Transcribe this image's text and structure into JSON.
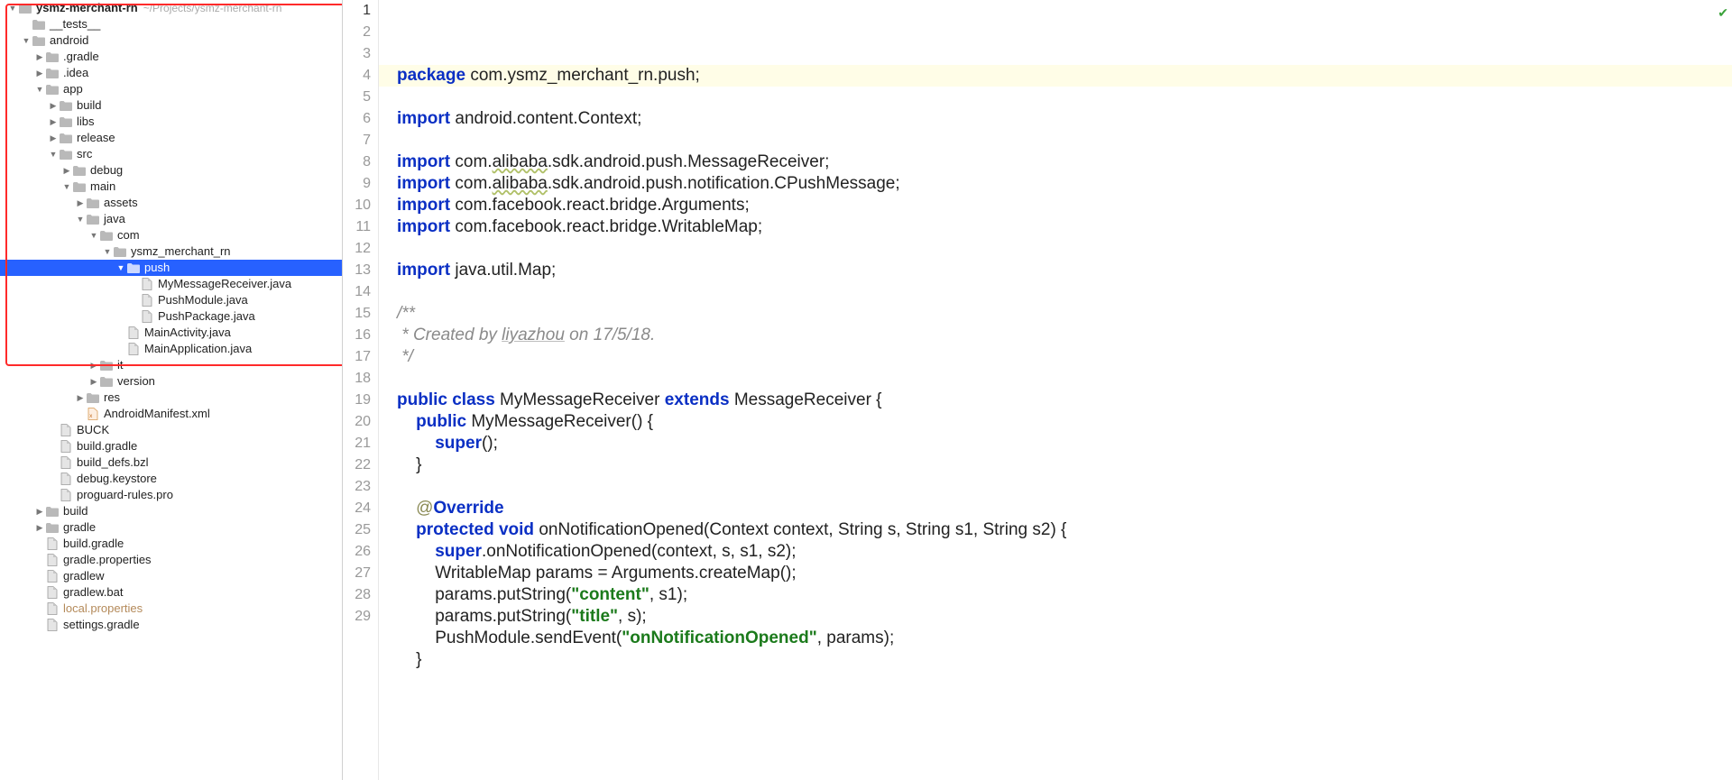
{
  "project": {
    "name": "ysmz-merchant-rn",
    "path": "~/Projects/ysmz-merchant-rn"
  },
  "tree": [
    {
      "d": 0,
      "t": "root",
      "a": "▼",
      "label": "ysmz-merchant-rn",
      "hint": "~/Projects/ysmz-merchant-rn",
      "bold": true
    },
    {
      "d": 1,
      "t": "folder",
      "a": "",
      "label": "__tests__"
    },
    {
      "d": 1,
      "t": "folder",
      "a": "▼",
      "label": "android"
    },
    {
      "d": 2,
      "t": "folder",
      "a": "▶",
      "label": ".gradle"
    },
    {
      "d": 2,
      "t": "folder",
      "a": "▶",
      "label": ".idea"
    },
    {
      "d": 2,
      "t": "folder",
      "a": "▼",
      "label": "app"
    },
    {
      "d": 3,
      "t": "folder",
      "a": "▶",
      "label": "build"
    },
    {
      "d": 3,
      "t": "folder",
      "a": "▶",
      "label": "libs"
    },
    {
      "d": 3,
      "t": "folder",
      "a": "▶",
      "label": "release"
    },
    {
      "d": 3,
      "t": "folder",
      "a": "▼",
      "label": "src"
    },
    {
      "d": 4,
      "t": "folder",
      "a": "▶",
      "label": "debug"
    },
    {
      "d": 4,
      "t": "folder",
      "a": "▼",
      "label": "main"
    },
    {
      "d": 5,
      "t": "folder",
      "a": "▶",
      "label": "assets"
    },
    {
      "d": 5,
      "t": "folder",
      "a": "▼",
      "label": "java"
    },
    {
      "d": 6,
      "t": "folder",
      "a": "▼",
      "label": "com"
    },
    {
      "d": 7,
      "t": "folder",
      "a": "▼",
      "label": "ysmz_merchant_rn"
    },
    {
      "d": 8,
      "t": "folder",
      "a": "▼",
      "label": "push",
      "selected": true
    },
    {
      "d": 9,
      "t": "file",
      "a": "",
      "label": "MyMessageReceiver.java"
    },
    {
      "d": 9,
      "t": "file",
      "a": "",
      "label": "PushModule.java"
    },
    {
      "d": 9,
      "t": "file",
      "a": "",
      "label": "PushPackage.java"
    },
    {
      "d": 8,
      "t": "file",
      "a": "",
      "label": "MainActivity.java"
    },
    {
      "d": 8,
      "t": "file",
      "a": "",
      "label": "MainApplication.java"
    },
    {
      "d": 6,
      "t": "folder",
      "a": "▶",
      "label": "it"
    },
    {
      "d": 6,
      "t": "folder",
      "a": "▶",
      "label": "version"
    },
    {
      "d": 5,
      "t": "folder",
      "a": "▶",
      "label": "res"
    },
    {
      "d": 5,
      "t": "xml",
      "a": "",
      "label": "AndroidManifest.xml"
    },
    {
      "d": 3,
      "t": "file",
      "a": "",
      "label": "BUCK"
    },
    {
      "d": 3,
      "t": "file",
      "a": "",
      "label": "build.gradle"
    },
    {
      "d": 3,
      "t": "file",
      "a": "",
      "label": "build_defs.bzl"
    },
    {
      "d": 3,
      "t": "file",
      "a": "",
      "label": "debug.keystore"
    },
    {
      "d": 3,
      "t": "file",
      "a": "",
      "label": "proguard-rules.pro"
    },
    {
      "d": 2,
      "t": "folder",
      "a": "▶",
      "label": "build"
    },
    {
      "d": 2,
      "t": "folder",
      "a": "▶",
      "label": "gradle"
    },
    {
      "d": 2,
      "t": "file",
      "a": "",
      "label": "build.gradle"
    },
    {
      "d": 2,
      "t": "file",
      "a": "",
      "label": "gradle.properties"
    },
    {
      "d": 2,
      "t": "file",
      "a": "",
      "label": "gradlew"
    },
    {
      "d": 2,
      "t": "file",
      "a": "",
      "label": "gradlew.bat"
    },
    {
      "d": 2,
      "t": "file",
      "a": "",
      "label": "local.properties",
      "dim": true
    },
    {
      "d": 2,
      "t": "file",
      "a": "",
      "label": "settings.gradle"
    }
  ],
  "gutter": {
    "from": 1,
    "to": 29,
    "current": 1
  },
  "code": {
    "l1": {
      "pre": "",
      "kw": "package",
      "post": " com.ysmz_merchant_rn.push;",
      "hl": true
    },
    "l2": {
      "plain": ""
    },
    "l3": {
      "pre": "",
      "kw": "import",
      "post": " android.content.Context;"
    },
    "l4": {
      "plain": ""
    },
    "l5": {
      "pre": "",
      "kw": "import",
      "post": " com.",
      "warn": "alibaba",
      "post2": ".sdk.android.push.MessageReceiver;"
    },
    "l6": {
      "pre": "",
      "kw": "import",
      "post": " com.",
      "warn": "alibaba",
      "post2": ".sdk.android.push.notification.CPushMessage;"
    },
    "l7": {
      "pre": "",
      "kw": "import",
      "post": " com.facebook.react.bridge.Arguments;"
    },
    "l8": {
      "pre": "",
      "kw": "import",
      "post": " com.facebook.react.bridge.WritableMap;"
    },
    "l9": {
      "plain": ""
    },
    "l10": {
      "pre": "",
      "kw": "import",
      "post": " java.util.Map;"
    },
    "l11": {
      "plain": ""
    },
    "l12": {
      "cm": "/**"
    },
    "l13": {
      "cm_pre": " * Created by ",
      "cm_u": "liyazhou",
      "cm_post": " on 17/5/18."
    },
    "l14": {
      "cm": " */"
    },
    "l15": {
      "plain": ""
    },
    "l16": {
      "tokens": [
        [
          "kw",
          "public"
        ],
        [
          "sp",
          " "
        ],
        [
          "kw",
          "class"
        ],
        [
          "txt",
          " MyMessageReceiver "
        ],
        [
          "kw",
          "extends"
        ],
        [
          "txt",
          " MessageReceiver {"
        ]
      ]
    },
    "l17": {
      "tokens": [
        [
          "ind",
          "    "
        ],
        [
          "kw",
          "public"
        ],
        [
          "txt",
          " MyMessageReceiver() {"
        ]
      ]
    },
    "l18": {
      "tokens": [
        [
          "ind",
          "        "
        ],
        [
          "kw",
          "super"
        ],
        [
          "txt",
          "();"
        ]
      ]
    },
    "l19": {
      "plain": "    }"
    },
    "l20": {
      "plain": ""
    },
    "l21": {
      "ann": "    @Override"
    },
    "l22": {
      "tokens": [
        [
          "ind",
          "    "
        ],
        [
          "kw",
          "protected"
        ],
        [
          "sp",
          " "
        ],
        [
          "kw",
          "void"
        ],
        [
          "txt",
          " onNotificationOpened(Context context, String s, String s1, String s2) {"
        ]
      ]
    },
    "l23": {
      "tokens": [
        [
          "ind",
          "        "
        ],
        [
          "kw",
          "super"
        ],
        [
          "txt",
          ".onNotificationOpened(context, s, s1, s2);"
        ]
      ]
    },
    "l24": {
      "plain": "        WritableMap params = Arguments.createMap();"
    },
    "l25": {
      "tokens": [
        [
          "ind",
          "        "
        ],
        [
          "txt",
          "params.putString("
        ],
        [
          "str",
          "\"content\""
        ],
        [
          "txt",
          ", s1);"
        ]
      ]
    },
    "l26": {
      "tokens": [
        [
          "ind",
          "        "
        ],
        [
          "txt",
          "params.putString("
        ],
        [
          "str",
          "\"title\""
        ],
        [
          "txt",
          ", s);"
        ]
      ]
    },
    "l27": {
      "tokens": [
        [
          "ind",
          "        "
        ],
        [
          "txt",
          "PushModule.sendEvent("
        ],
        [
          "str",
          "\"onNotificationOpened\""
        ],
        [
          "txt",
          ", params);"
        ]
      ]
    },
    "l28": {
      "plain": "    }"
    },
    "l29": {
      "plain": ""
    }
  },
  "corner_check": "✔"
}
